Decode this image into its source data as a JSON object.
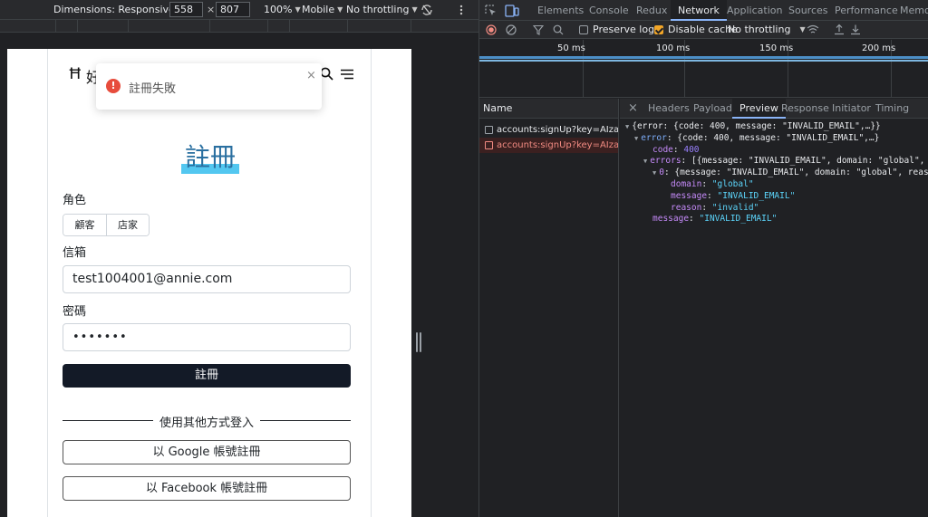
{
  "emulation": {
    "dimensions_label": "Dimensions: Responsive",
    "width": "558",
    "times": "×",
    "height": "807",
    "zoom": "100%",
    "device_type": "Mobile",
    "throttling": "No throttling"
  },
  "site": {
    "logo_mark": "Ħ",
    "logo_text": "好",
    "toast": {
      "icon": "!",
      "message": "註冊失敗",
      "close": "×"
    },
    "title": "註冊",
    "role_label": "角色",
    "roles": [
      "顧客",
      "店家"
    ],
    "email_label": "信箱",
    "email_value": "test1004001@annie.com",
    "password_label": "密碼",
    "password_value": "•••••••",
    "submit_label": "註冊",
    "divider_text": "使用其他方式登入",
    "google_button": "以 Google 帳號註冊",
    "facebook_button": "以 Facebook 帳號註冊"
  },
  "devtools": {
    "tabs": [
      "Elements",
      "Console",
      "Redux",
      "Network",
      "Application",
      "Sources",
      "Performance",
      "Memor"
    ],
    "active_tab": "Network",
    "toolbar": {
      "preserve_log": "Preserve log",
      "disable_cache": "Disable cache",
      "throttling": "No throttling"
    },
    "timeline_ticks": [
      "50 ms",
      "100 ms",
      "150 ms",
      "200 ms"
    ],
    "name_header": "Name",
    "requests": [
      {
        "name": "accounts:signUp?key=AIzaSy...",
        "status": "ok"
      },
      {
        "name": "accounts:signUp?key=AIzaSy...",
        "status": "error"
      }
    ],
    "preview_close": "×",
    "preview_tabs": [
      "Headers",
      "Payload",
      "Preview",
      "Response",
      "Initiator",
      "Timing"
    ],
    "active_preview_tab": "Preview",
    "json": {
      "l1_prefix": "{error: {code: 400, message: \"INVALID_EMAIL\",…}}",
      "l2_key": "error",
      "l2_val": "{code: 400, message: \"INVALID_EMAIL\",…}",
      "code_key": "code",
      "code_val": "400",
      "errors_key": "errors",
      "errors_val": "[{message: \"INVALID_EMAIL\", domain: \"global\", reas",
      "idx_key": "0",
      "idx_val": "{message: \"INVALID_EMAIL\", domain: \"global\", reason: \"",
      "domain_key": "domain",
      "domain_val": "\"global\"",
      "message_key": "message",
      "message_val": "\"INVALID_EMAIL\"",
      "reason_key": "reason",
      "reason_val": "\"invalid\"",
      "outer_message_key": "message",
      "outer_message_val": "\"INVALID_EMAIL\""
    }
  },
  "colors": {
    "accent_blue": "#8ab4f8",
    "error_red": "#e74c3c",
    "primary_dark": "#131a27",
    "title_highlight": "#53c7f0"
  }
}
